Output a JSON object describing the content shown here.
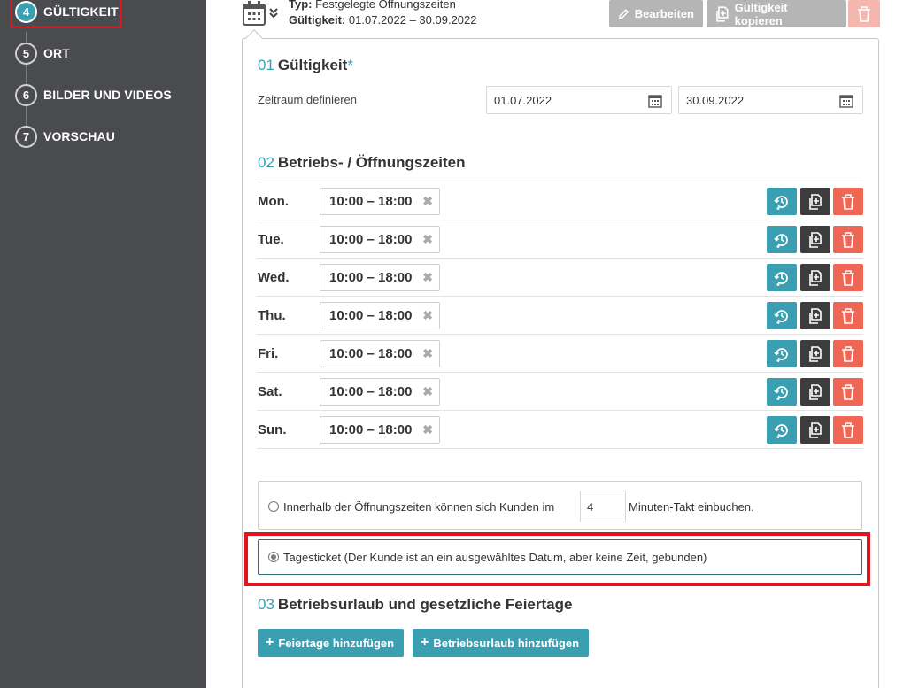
{
  "sidebar": {
    "steps": [
      {
        "num": "4",
        "label": "GÜLTIGKEIT",
        "active": true
      },
      {
        "num": "5",
        "label": "ORT"
      },
      {
        "num": "6",
        "label": "BILDER UND VIDEOS"
      },
      {
        "num": "7",
        "label": "VORSCHAU"
      }
    ]
  },
  "header": {
    "type_label": "Typ:",
    "type_value": "Festgelegte Öffnungszeiten",
    "validity_label": "Gültigkeit:",
    "validity_value": "01.07.2022 – 30.09.2022",
    "edit_label": "Bearbeiten",
    "copy_label": "Gültigkeit kopieren"
  },
  "section1": {
    "num": "01",
    "title": "Gültigkeit",
    "required_mark": "*",
    "range_label": "Zeitraum definieren",
    "date_from": "01.07.2022",
    "date_to": "30.09.2022"
  },
  "section2": {
    "num": "02",
    "title": "Betriebs- / Öffnungszeiten",
    "days": [
      {
        "day": "Mon.",
        "time": "10:00 – 18:00"
      },
      {
        "day": "Tue.",
        "time": "10:00 – 18:00"
      },
      {
        "day": "Wed.",
        "time": "10:00 – 18:00"
      },
      {
        "day": "Thu.",
        "time": "10:00 – 18:00"
      },
      {
        "day": "Fri.",
        "time": "10:00 – 18:00"
      },
      {
        "day": "Sat.",
        "time": "10:00 – 18:00"
      },
      {
        "day": "Sun.",
        "time": "10:00 – 18:00"
      }
    ]
  },
  "booking": {
    "option1_before": "Innerhalb der Öffnungszeiten können sich Kunden im",
    "option1_minutes": "4",
    "option1_after": "Minuten-Takt einbuchen.",
    "option2": "Tagesticket (Der Kunde ist an ein ausgewähltes Datum, aber keine Zeit, gebunden)",
    "selected": "option2"
  },
  "section3": {
    "num": "03",
    "title": "Betriebsurlaub und gesetzliche Feiertage",
    "add_holidays": "Feiertage hinzufügen",
    "add_vacation": "Betriebsurlaub hinzufügen"
  },
  "colors": {
    "accent": "#3a9fb0",
    "sidebar_bg": "#4a4b4f",
    "delete": "#ee6654",
    "highlight": "#e2131c"
  }
}
